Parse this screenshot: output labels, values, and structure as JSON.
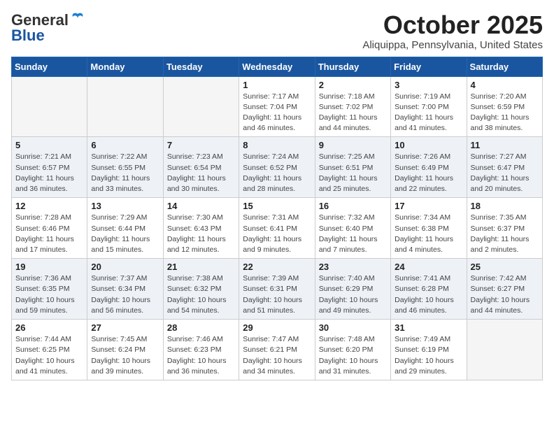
{
  "header": {
    "logo_general": "General",
    "logo_blue": "Blue",
    "month": "October 2025",
    "location": "Aliquippa, Pennsylvania, United States"
  },
  "days_of_week": [
    "Sunday",
    "Monday",
    "Tuesday",
    "Wednesday",
    "Thursday",
    "Friday",
    "Saturday"
  ],
  "weeks": [
    {
      "shaded": false,
      "days": [
        {
          "num": "",
          "info": ""
        },
        {
          "num": "",
          "info": ""
        },
        {
          "num": "",
          "info": ""
        },
        {
          "num": "1",
          "info": "Sunrise: 7:17 AM\nSunset: 7:04 PM\nDaylight: 11 hours\nand 46 minutes."
        },
        {
          "num": "2",
          "info": "Sunrise: 7:18 AM\nSunset: 7:02 PM\nDaylight: 11 hours\nand 44 minutes."
        },
        {
          "num": "3",
          "info": "Sunrise: 7:19 AM\nSunset: 7:00 PM\nDaylight: 11 hours\nand 41 minutes."
        },
        {
          "num": "4",
          "info": "Sunrise: 7:20 AM\nSunset: 6:59 PM\nDaylight: 11 hours\nand 38 minutes."
        }
      ]
    },
    {
      "shaded": true,
      "days": [
        {
          "num": "5",
          "info": "Sunrise: 7:21 AM\nSunset: 6:57 PM\nDaylight: 11 hours\nand 36 minutes."
        },
        {
          "num": "6",
          "info": "Sunrise: 7:22 AM\nSunset: 6:55 PM\nDaylight: 11 hours\nand 33 minutes."
        },
        {
          "num": "7",
          "info": "Sunrise: 7:23 AM\nSunset: 6:54 PM\nDaylight: 11 hours\nand 30 minutes."
        },
        {
          "num": "8",
          "info": "Sunrise: 7:24 AM\nSunset: 6:52 PM\nDaylight: 11 hours\nand 28 minutes."
        },
        {
          "num": "9",
          "info": "Sunrise: 7:25 AM\nSunset: 6:51 PM\nDaylight: 11 hours\nand 25 minutes."
        },
        {
          "num": "10",
          "info": "Sunrise: 7:26 AM\nSunset: 6:49 PM\nDaylight: 11 hours\nand 22 minutes."
        },
        {
          "num": "11",
          "info": "Sunrise: 7:27 AM\nSunset: 6:47 PM\nDaylight: 11 hours\nand 20 minutes."
        }
      ]
    },
    {
      "shaded": false,
      "days": [
        {
          "num": "12",
          "info": "Sunrise: 7:28 AM\nSunset: 6:46 PM\nDaylight: 11 hours\nand 17 minutes."
        },
        {
          "num": "13",
          "info": "Sunrise: 7:29 AM\nSunset: 6:44 PM\nDaylight: 11 hours\nand 15 minutes."
        },
        {
          "num": "14",
          "info": "Sunrise: 7:30 AM\nSunset: 6:43 PM\nDaylight: 11 hours\nand 12 minutes."
        },
        {
          "num": "15",
          "info": "Sunrise: 7:31 AM\nSunset: 6:41 PM\nDaylight: 11 hours\nand 9 minutes."
        },
        {
          "num": "16",
          "info": "Sunrise: 7:32 AM\nSunset: 6:40 PM\nDaylight: 11 hours\nand 7 minutes."
        },
        {
          "num": "17",
          "info": "Sunrise: 7:34 AM\nSunset: 6:38 PM\nDaylight: 11 hours\nand 4 minutes."
        },
        {
          "num": "18",
          "info": "Sunrise: 7:35 AM\nSunset: 6:37 PM\nDaylight: 11 hours\nand 2 minutes."
        }
      ]
    },
    {
      "shaded": true,
      "days": [
        {
          "num": "19",
          "info": "Sunrise: 7:36 AM\nSunset: 6:35 PM\nDaylight: 10 hours\nand 59 minutes."
        },
        {
          "num": "20",
          "info": "Sunrise: 7:37 AM\nSunset: 6:34 PM\nDaylight: 10 hours\nand 56 minutes."
        },
        {
          "num": "21",
          "info": "Sunrise: 7:38 AM\nSunset: 6:32 PM\nDaylight: 10 hours\nand 54 minutes."
        },
        {
          "num": "22",
          "info": "Sunrise: 7:39 AM\nSunset: 6:31 PM\nDaylight: 10 hours\nand 51 minutes."
        },
        {
          "num": "23",
          "info": "Sunrise: 7:40 AM\nSunset: 6:29 PM\nDaylight: 10 hours\nand 49 minutes."
        },
        {
          "num": "24",
          "info": "Sunrise: 7:41 AM\nSunset: 6:28 PM\nDaylight: 10 hours\nand 46 minutes."
        },
        {
          "num": "25",
          "info": "Sunrise: 7:42 AM\nSunset: 6:27 PM\nDaylight: 10 hours\nand 44 minutes."
        }
      ]
    },
    {
      "shaded": false,
      "days": [
        {
          "num": "26",
          "info": "Sunrise: 7:44 AM\nSunset: 6:25 PM\nDaylight: 10 hours\nand 41 minutes."
        },
        {
          "num": "27",
          "info": "Sunrise: 7:45 AM\nSunset: 6:24 PM\nDaylight: 10 hours\nand 39 minutes."
        },
        {
          "num": "28",
          "info": "Sunrise: 7:46 AM\nSunset: 6:23 PM\nDaylight: 10 hours\nand 36 minutes."
        },
        {
          "num": "29",
          "info": "Sunrise: 7:47 AM\nSunset: 6:21 PM\nDaylight: 10 hours\nand 34 minutes."
        },
        {
          "num": "30",
          "info": "Sunrise: 7:48 AM\nSunset: 6:20 PM\nDaylight: 10 hours\nand 31 minutes."
        },
        {
          "num": "31",
          "info": "Sunrise: 7:49 AM\nSunset: 6:19 PM\nDaylight: 10 hours\nand 29 minutes."
        },
        {
          "num": "",
          "info": ""
        }
      ]
    }
  ]
}
